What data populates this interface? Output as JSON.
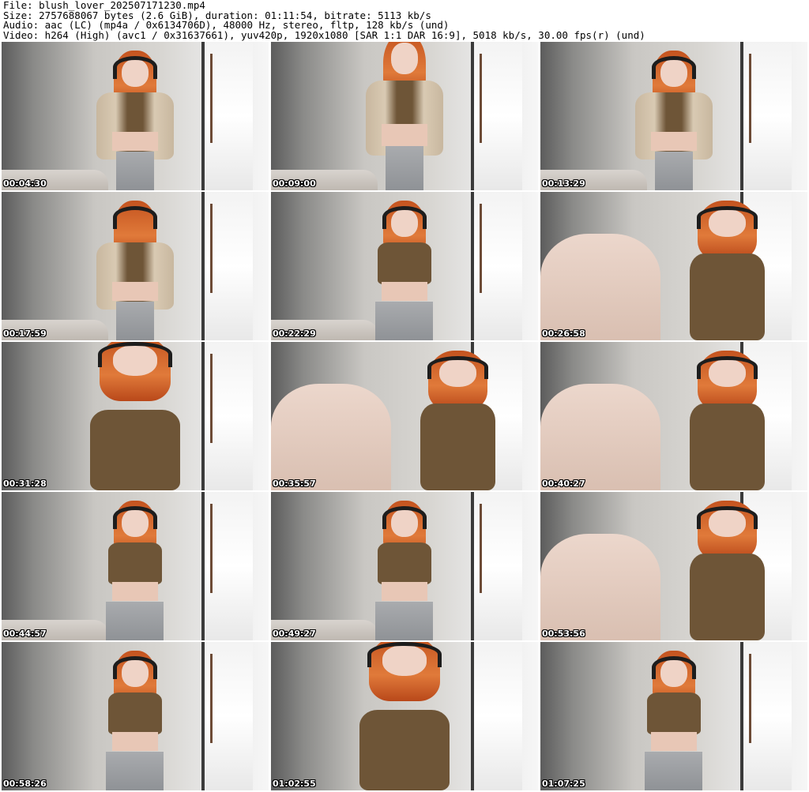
{
  "header": {
    "file_line": "File: blush_lover_202507171230.mp4",
    "size_line": "Size: 2757688067 bytes (2.6 GiB), duration: 01:11:54, bitrate: 5113 kb/s",
    "audio_line": "Audio: aac (LC) (mp4a / 0x6134706D), 48000 Hz, stereo, fltp, 128 kb/s (und)",
    "video_line": "Video: h264 (High) (avc1 / 0x31637661), yuv420p, 1920x1080 [SAR 1:1 DAR 16:9], 5018 kb/s, 30.00 fps(r) (und)"
  },
  "thumbnails": [
    {
      "timestamp": "00:04:30"
    },
    {
      "timestamp": "00:09:00"
    },
    {
      "timestamp": "00:13:29"
    },
    {
      "timestamp": "00:17:59"
    },
    {
      "timestamp": "00:22:29"
    },
    {
      "timestamp": "00:26:58"
    },
    {
      "timestamp": "00:31:28"
    },
    {
      "timestamp": "00:35:57"
    },
    {
      "timestamp": "00:40:27"
    },
    {
      "timestamp": "00:44:57"
    },
    {
      "timestamp": "00:49:27"
    },
    {
      "timestamp": "00:53:56"
    },
    {
      "timestamp": "00:58:26"
    },
    {
      "timestamp": "01:02:55"
    },
    {
      "timestamp": "01:07:25"
    }
  ]
}
